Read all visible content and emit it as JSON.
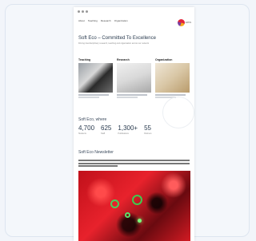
{
  "nav": {
    "links": [
      "About",
      "Teaching",
      "Research",
      "Organization"
    ],
    "logo_text": "EPOS"
  },
  "hero": {
    "title": "Soft Eco – Committed To Excellence",
    "subtitle": "Driving interdisciplinary research, teaching and organisation across our network"
  },
  "columns": [
    {
      "heading": "Teaching"
    },
    {
      "heading": "Research"
    },
    {
      "heading": "Organization"
    }
  ],
  "stats": {
    "heading": "Soft Eco, where",
    "items": [
      {
        "value": "4,700",
        "label": "Students"
      },
      {
        "value": "625",
        "label": "Staff"
      },
      {
        "value": "1,300+",
        "label": "Publications"
      },
      {
        "value": "55",
        "label": "Partners"
      }
    ]
  },
  "featured": {
    "title": "Soft Eco Newsletter"
  },
  "colors": {
    "page_bg": "#f2f5fa",
    "title_color": "#2a3b4f",
    "image_red": "#e8222c",
    "ring_green": "#49d25a"
  }
}
